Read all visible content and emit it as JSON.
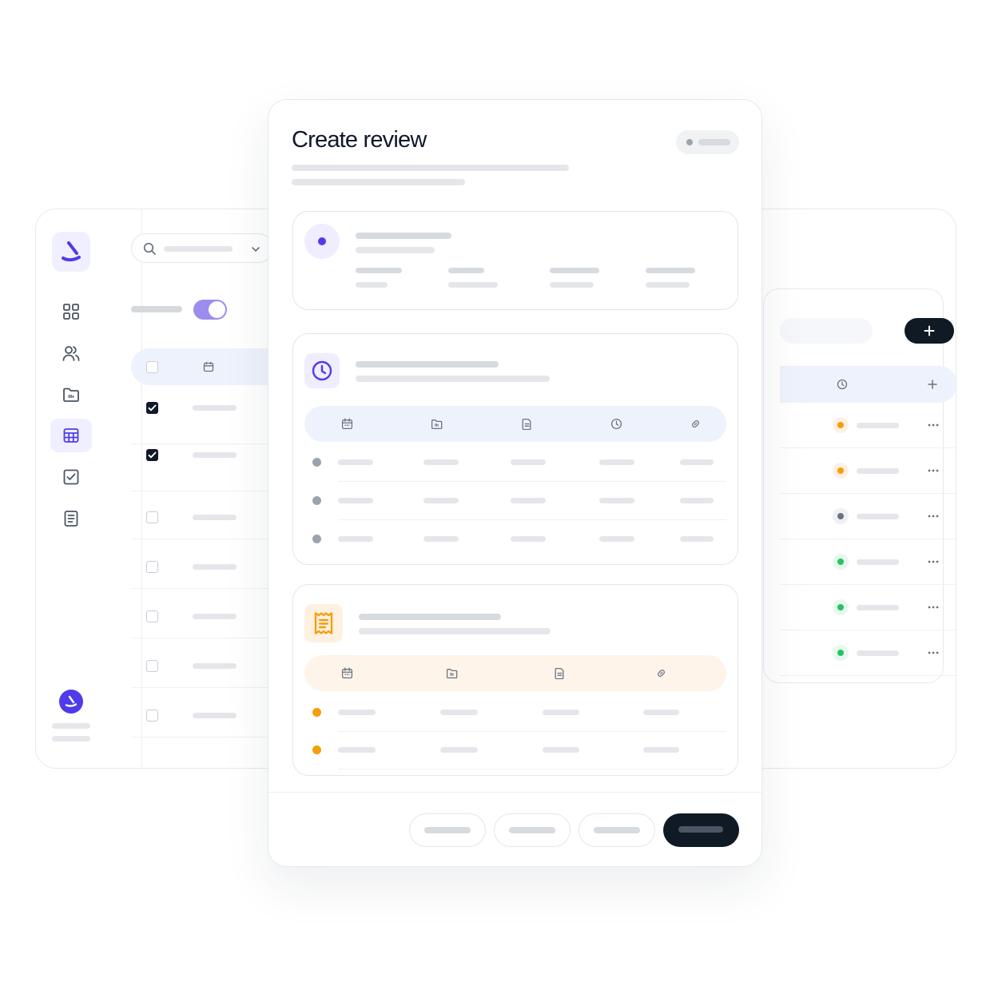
{
  "modal": {
    "title": "Create review"
  },
  "colors": {
    "accent": "#4f3bea",
    "dark": "#0f172a",
    "orange": "#f59e0b",
    "green": "#22c55e",
    "gray_dot": "#9ca3af"
  },
  "sidebar": {
    "items": [
      {
        "icon": "grid-icon"
      },
      {
        "icon": "users-icon"
      },
      {
        "icon": "folder-icon"
      },
      {
        "icon": "calendar-grid-icon",
        "active": true
      },
      {
        "icon": "checkbox-icon"
      },
      {
        "icon": "document-icon"
      }
    ]
  },
  "table": {
    "rows_checked": [
      true,
      true,
      false,
      false,
      false,
      false,
      false
    ]
  },
  "right_panel": {
    "status_colors": [
      "orange",
      "orange",
      "gray",
      "green",
      "green",
      "green"
    ]
  }
}
